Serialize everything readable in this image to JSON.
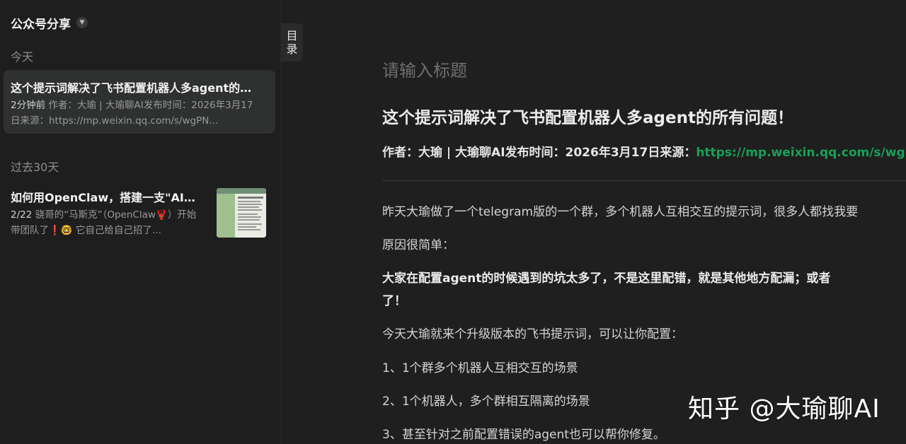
{
  "sidebar": {
    "header_title": "公众号分享",
    "section_today": "今天",
    "section_past30": "过去30天",
    "items": [
      {
        "title": "这个提示词解决了飞书配置机器人多agent的所有问题！",
        "time": "2分钟前",
        "preview": "作者：大瑜 | 大瑜聊AI发布时间：2026年3月17日来源：https://mp.weixin.qq.com/s/wgPN..."
      },
      {
        "title": "如何用OpenClaw，搭建一支\"AI团队\"",
        "time": "2/22",
        "preview": "骁哥的“马斯克”（OpenClaw🦞）开始带团队了❗🤓 它自己给自己招了..."
      }
    ]
  },
  "toc_label": "目录",
  "editor": {
    "title_placeholder": "请输入标题",
    "heading": "这个提示词解决了飞书配置机器人多agent的所有问题！",
    "meta_prefix": "作者：大瑜 | 大瑜聊AI发布时间：2026年3月17日来源：",
    "meta_link": "https://mp.weixin.qq.com/s/wgPN",
    "paragraphs": [
      "昨天大瑜做了一个telegram版的一个群，多个机器人互相交互的提示词，很多人都找我要",
      "原因很简单：",
      "大家在配置agent的时候遇到的坑太多了，不是这里配错，就是其他地方配漏；或者",
      "了！",
      "今天大瑜就来个升级版本的飞书提示词，可以让你配置：",
      "1、1个群多个机器人互相交互的场景",
      "2、1个机器人，多个群相互隔离的场景",
      "3、甚至针对之前配置错误的agent也可以帮你修复。"
    ]
  },
  "watermark": "知乎 @大瑜聊AI",
  "colors": {
    "background": "#1f1f1f",
    "selected_card": "#2e312f",
    "link_green": "#18a058"
  }
}
